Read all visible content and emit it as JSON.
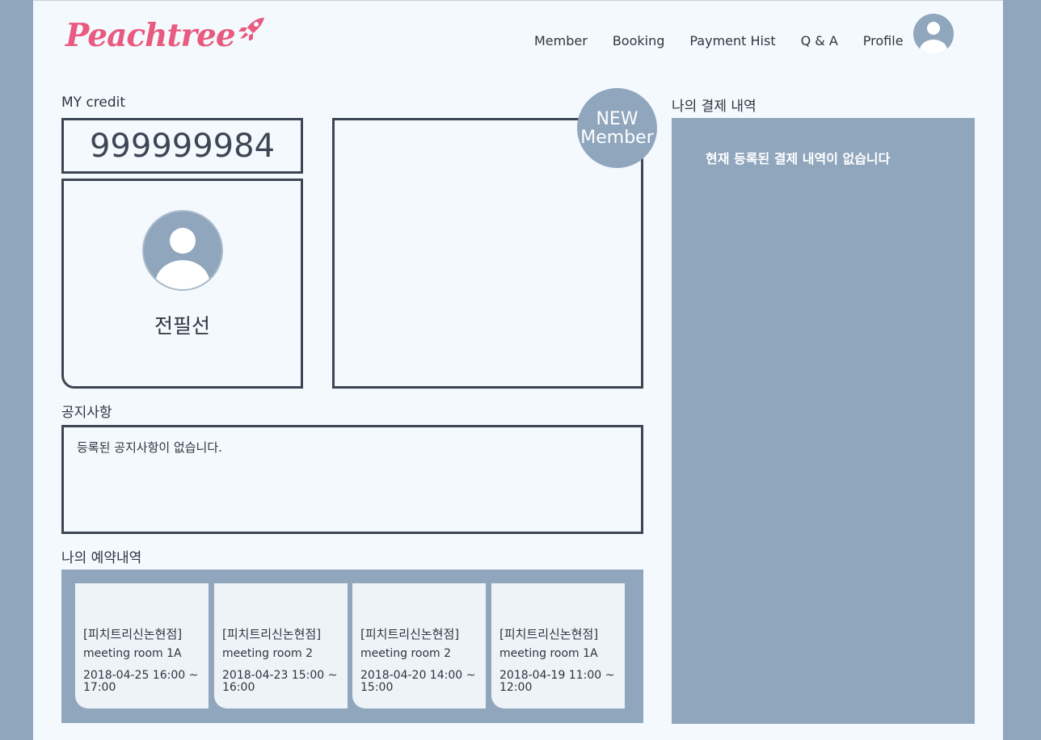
{
  "header": {
    "logo_text": "Peachtree",
    "logo_icon": "rocket-icon",
    "nav": [
      "Member",
      "Booking",
      "Payment Hist",
      "Q & A",
      "Profile"
    ],
    "avatar_icon": "user-avatar-icon"
  },
  "credit": {
    "label": "MY credit",
    "value": "999999984"
  },
  "profile": {
    "name": "전필선"
  },
  "membership": {
    "badge_line1": "NEW",
    "badge_line2": "Member"
  },
  "notice": {
    "label": "공지사항",
    "empty_text": "등록된 공지사항이 없습니다."
  },
  "bookings": {
    "label": "나의 예약내역",
    "items": [
      {
        "branch": "[피치트리신논현점]",
        "room": "meeting room 1A",
        "time": "2018-04-25 16:00 ~ 17:00"
      },
      {
        "branch": "[피치트리신논현점]",
        "room": "meeting room 2",
        "time": "2018-04-23 15:00 ~ 16:00"
      },
      {
        "branch": "[피치트리신논현점]",
        "room": "meeting room 2",
        "time": "2018-04-20 14:00 ~ 15:00"
      },
      {
        "branch": "[피치트리신논현점]",
        "room": "meeting room 1A",
        "time": "2018-04-19 11:00 ~ 12:00"
      }
    ]
  },
  "payments": {
    "label": "나의 결제 내역",
    "empty_text": "현재 등록된 결제 내역이 없습니다"
  },
  "colors": {
    "brand": "#e85a7f",
    "panel": "#8fa6bd",
    "border": "#3d4654",
    "background": "#f4f9fd"
  }
}
